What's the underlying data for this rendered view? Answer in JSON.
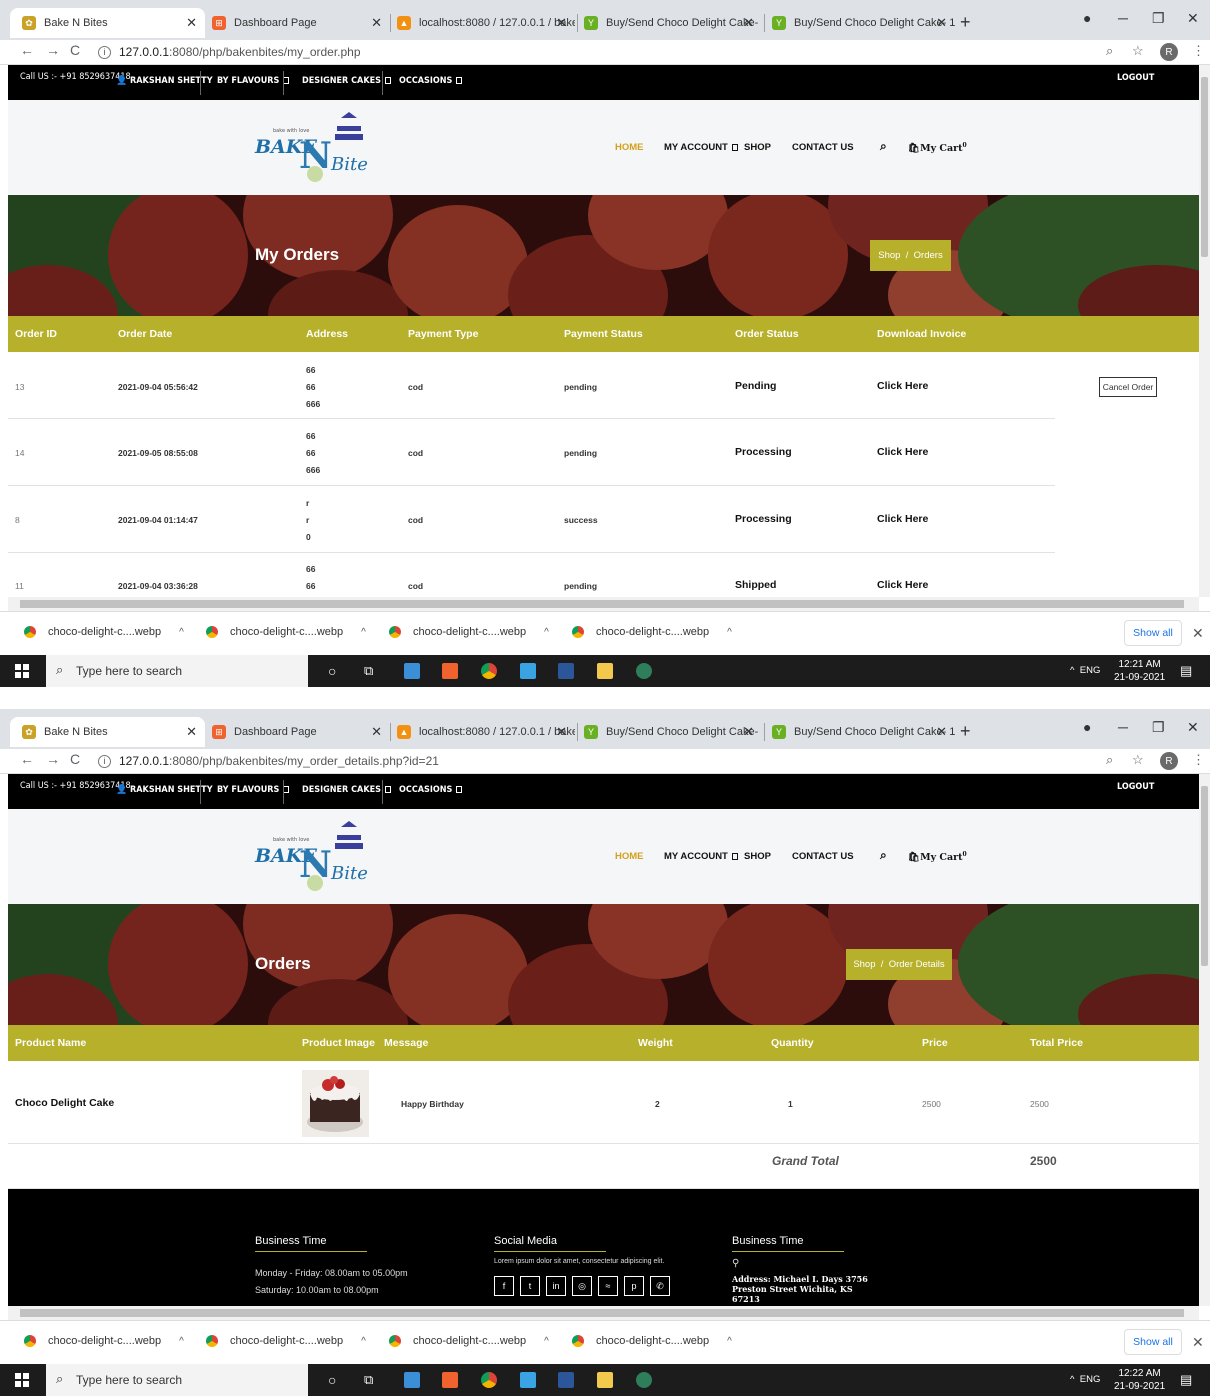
{
  "browser": {
    "tabs": [
      {
        "title": "Bake N Bites",
        "icon": "cake-favicon"
      },
      {
        "title": "Dashboard Page",
        "icon": "dashboard-favicon"
      },
      {
        "title": "localhost:8080 / 127.0.0.1 / baker",
        "icon": "phpmyadmin-favicon"
      },
      {
        "title": "Buy/Send Choco Delight Cake- 1",
        "icon": "shop-favicon"
      },
      {
        "title": "Buy/Send Choco Delight Cake- 1",
        "icon": "shop-favicon"
      }
    ],
    "url_host": "127.0.0.1",
    "url_path_1": ":8080/php/bakenbites/my_order.php",
    "url_path_2": ":8080/php/bakenbites/my_order_details.php?id=21",
    "profile_letter": "R"
  },
  "topbar": {
    "call": "Call US :- +91 8529637418",
    "user": "RAKSHAN SHETTY",
    "by_flavours": "BY FLAVOURS",
    "designer_cakes": "DESIGNER CAKES",
    "occasions": "OCCASIONS",
    "logout": "LOGOUT"
  },
  "menu": {
    "home": "HOME",
    "my_account": "MY ACCOUNT",
    "shop": "SHOP",
    "contact": "CONTACT US",
    "cart": "My Cart",
    "cart_count": "0"
  },
  "logo": {
    "bake": "BAKE",
    "n": "N",
    "bite": "Bite",
    "tag": "bake with love"
  },
  "orders_page": {
    "title": "My Orders",
    "crumb_shop": "Shop",
    "crumb_sep": "/",
    "crumb_current": "Orders",
    "headers": [
      "Order ID",
      "Order Date",
      "Address",
      "Payment Type",
      "Payment Status",
      "Order Status",
      "Download Invoice"
    ],
    "rows": [
      {
        "id": "13",
        "date": "2021-09-04 05:56:42",
        "addr": [
          "66",
          "66",
          "666"
        ],
        "ptype": "cod",
        "pstatus": "pending",
        "ostatus": "Pending",
        "invoice": "Click Here"
      },
      {
        "id": "14",
        "date": "2021-09-05 08:55:08",
        "addr": [
          "66",
          "66",
          "666"
        ],
        "ptype": "cod",
        "pstatus": "pending",
        "ostatus": "Processing",
        "invoice": "Click Here"
      },
      {
        "id": "8",
        "date": "2021-09-04 01:14:47",
        "addr": [
          "r",
          "r",
          "0"
        ],
        "ptype": "cod",
        "pstatus": "success",
        "ostatus": "Processing",
        "invoice": "Click Here"
      },
      {
        "id": "11",
        "date": "2021-09-04 03:36:28",
        "addr": [
          "66",
          "66",
          ""
        ],
        "ptype": "cod",
        "pstatus": "pending",
        "ostatus": "Shipped",
        "invoice": "Click Here"
      }
    ],
    "cancel": "Cancel Order"
  },
  "details_page": {
    "title": "Orders",
    "crumb_shop": "Shop",
    "crumb_sep": "/",
    "crumb_current": "Order Details",
    "headers": [
      "Product Name",
      "Product Image",
      "Message",
      "Weight",
      "Quantity",
      "Price",
      "Total Price"
    ],
    "row": {
      "name": "Choco Delight Cake",
      "message": "Happy Birthday",
      "weight": "2",
      "qty": "1",
      "price": "2500",
      "total": "2500"
    },
    "grand_label": "Grand Total",
    "grand_value": "2500"
  },
  "footer": {
    "col1_title": "Business Time",
    "col1_line1": "Monday - Friday: 08.00am to 05.00pm",
    "col1_line2": "Saturday: 10.00am to 08.00pm",
    "col2_title": "Social Media",
    "col2_text": "Lorem ipsum dolor sit amet, consectetur adipiscing elit.",
    "col3_title": "Business Time",
    "col3_address": "Address: Michael I. Days 3756 Preston Street Wichita, KS 67213"
  },
  "downloads": {
    "items": [
      "choco-delight-c....webp",
      "choco-delight-c....webp",
      "choco-delight-c....webp",
      "choco-delight-c....webp"
    ],
    "show_all": "Show all"
  },
  "taskbar": {
    "search_placeholder": "Type here to search",
    "lang": "ENG",
    "time1": "12:21 AM",
    "time2": "12:22 AM",
    "date": "21-09-2021"
  },
  "colors": {
    "accent": "#b6b02a",
    "home": "#d4a020",
    "topbar": "#000000"
  }
}
